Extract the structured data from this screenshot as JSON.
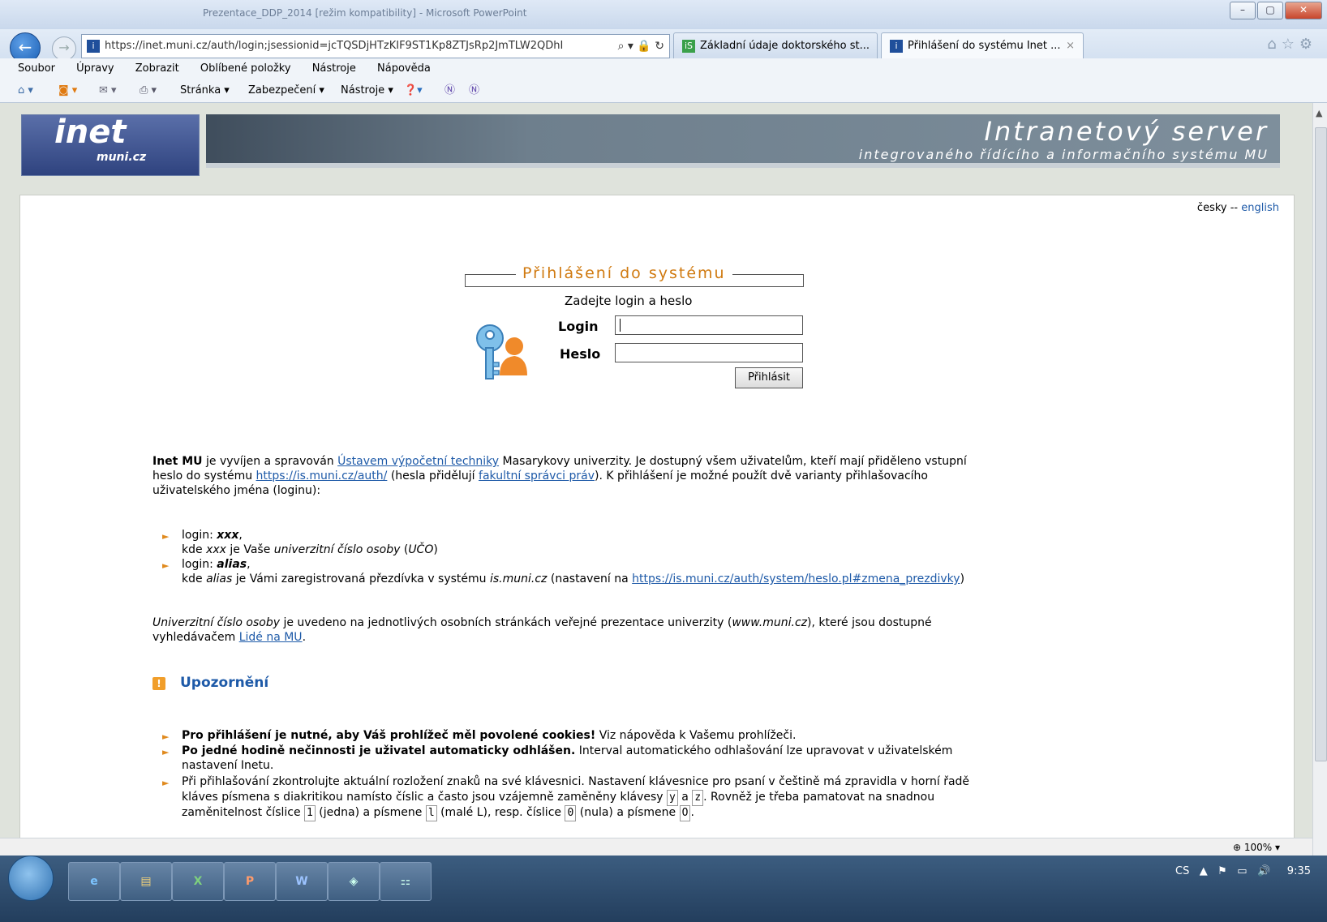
{
  "window": {
    "title": "Prezentace_DDP_2014 [režim kompatibility] - Microsoft PowerPoint"
  },
  "browser": {
    "url": "https://inet.muni.cz/auth/login;jsessionid=jcTQSDjHTzKIF9ST1Kp8ZTJsRp2JmTLW2QDhI",
    "tabs": [
      {
        "label": "Základní údaje doktorského st..."
      },
      {
        "label": "Přihlášení do systému Inet ...",
        "close": "×"
      }
    ],
    "menu": [
      "Soubor",
      "Úpravy",
      "Zobrazit",
      "Oblíbené položky",
      "Nástroje",
      "Nápověda"
    ],
    "commands": [
      "Stránka ▾",
      "Zabezpečení ▾",
      "Nástroje ▾"
    ],
    "zoom": "100%"
  },
  "header": {
    "logo_main": "inet",
    "logo_sub": "muni.cz",
    "banner_title": "Intranetový server",
    "banner_subtitle": "integrovaného řídícího a informačního systému MU"
  },
  "lang": {
    "czech": "česky",
    "sep": " -- ",
    "english": "english"
  },
  "login": {
    "title": "Přihlášení do systému",
    "prompt": "Zadejte login a heslo",
    "login_label": "Login",
    "password_label": "Heslo",
    "submit": "Přihlásit"
  },
  "intro": {
    "p1_bold": "Inet MU",
    "p1_a": " je vyvíjen a spravován ",
    "p1_link1": "Ústavem výpočetní techniky",
    "p1_b": " Masarykovy univerzity. Je dostupný všem uživatelům, kteří mají přiděleno vstupní",
    "p2_a": "heslo do systému ",
    "p2_link": "https://is.muni.cz/auth/",
    "p2_b": " (hesla přidělují ",
    "p2_link2": "fakultní správci práv",
    "p2_c": "). K přihlášení je možné použít dvě varianty přihlašovacího",
    "p3": "uživatelského jména (loginu):"
  },
  "variants": [
    {
      "l1_a": "login: ",
      "l1_b": "xxx",
      "l1_c": ",",
      "l2_a": "kde ",
      "l2_b": "xxx",
      "l2_c": " je Vaše ",
      "l2_d": "univerzitní číslo osoby",
      "l2_e": " (",
      "l2_f": "UČO",
      "l2_g": ")"
    },
    {
      "l1_a": "login: ",
      "l1_b": "alias",
      "l1_c": ",",
      "l2_a": "kde ",
      "l2_b": "alias",
      "l2_c": " je Vámi zaregistrovaná přezdívka v systému ",
      "l2_d": "is.muni.cz",
      "l2_e": " (nastavení na ",
      "l2_link": "https://is.muni.cz/auth/system/heslo.pl#zmena_prezdivky",
      "l2_f": ")"
    }
  ],
  "uco": {
    "a": "Univerzitní číslo osoby",
    "b": " je uvedeno na jednotlivých osobních stránkách veřejné prezentace univerzity (",
    "c": "www.muni.cz",
    "d": "), které jsou dostupné",
    "e": "vyhledávačem ",
    "link": "Lidé na MU",
    "f": "."
  },
  "warning": {
    "heading": "Upozornění",
    "i1_bold": "Pro přihlášení je nutné, aby Váš prohlížeč měl povolené cookies!",
    "i1_rest": " Viz nápověda k Vašemu prohlížeči.",
    "i2_bold": "Po jedné hodině nečinnosti je uživatel automaticky odhlášen.",
    "i2_rest": " Interval automatického odhlašování lze upravovat v uživatelském",
    "i2_line2": "nastavení Inetu.",
    "i3_l1": "Při přihlašování zkontrolujte aktuální rozložení znaků na své klávesnici. Nastavení klávesnice pro psaní v češtině má zpravidla v horní řadě",
    "i3_l2a": "kláves písmena s diakritikou namísto číslic a často jsou vzájemně zaměněny klávesy ",
    "k_y": "y",
    "i3_and": " a ",
    "k_z": "z",
    "i3_l2b": ". Rovněž je třeba pamatovat na snadnou",
    "i3_l3a": "zaměnitelnost číslice ",
    "k_1": "1",
    "i3_l3b": " (jedna) a písmene ",
    "k_l": "l",
    "i3_l3c": " (malé L), resp. číslice ",
    "k_0": "0",
    "i3_l3d": " (nula) a písmene ",
    "k_O": "O",
    "i3_l3e": "."
  },
  "tray": {
    "lang": "CS",
    "time": "9:35"
  }
}
